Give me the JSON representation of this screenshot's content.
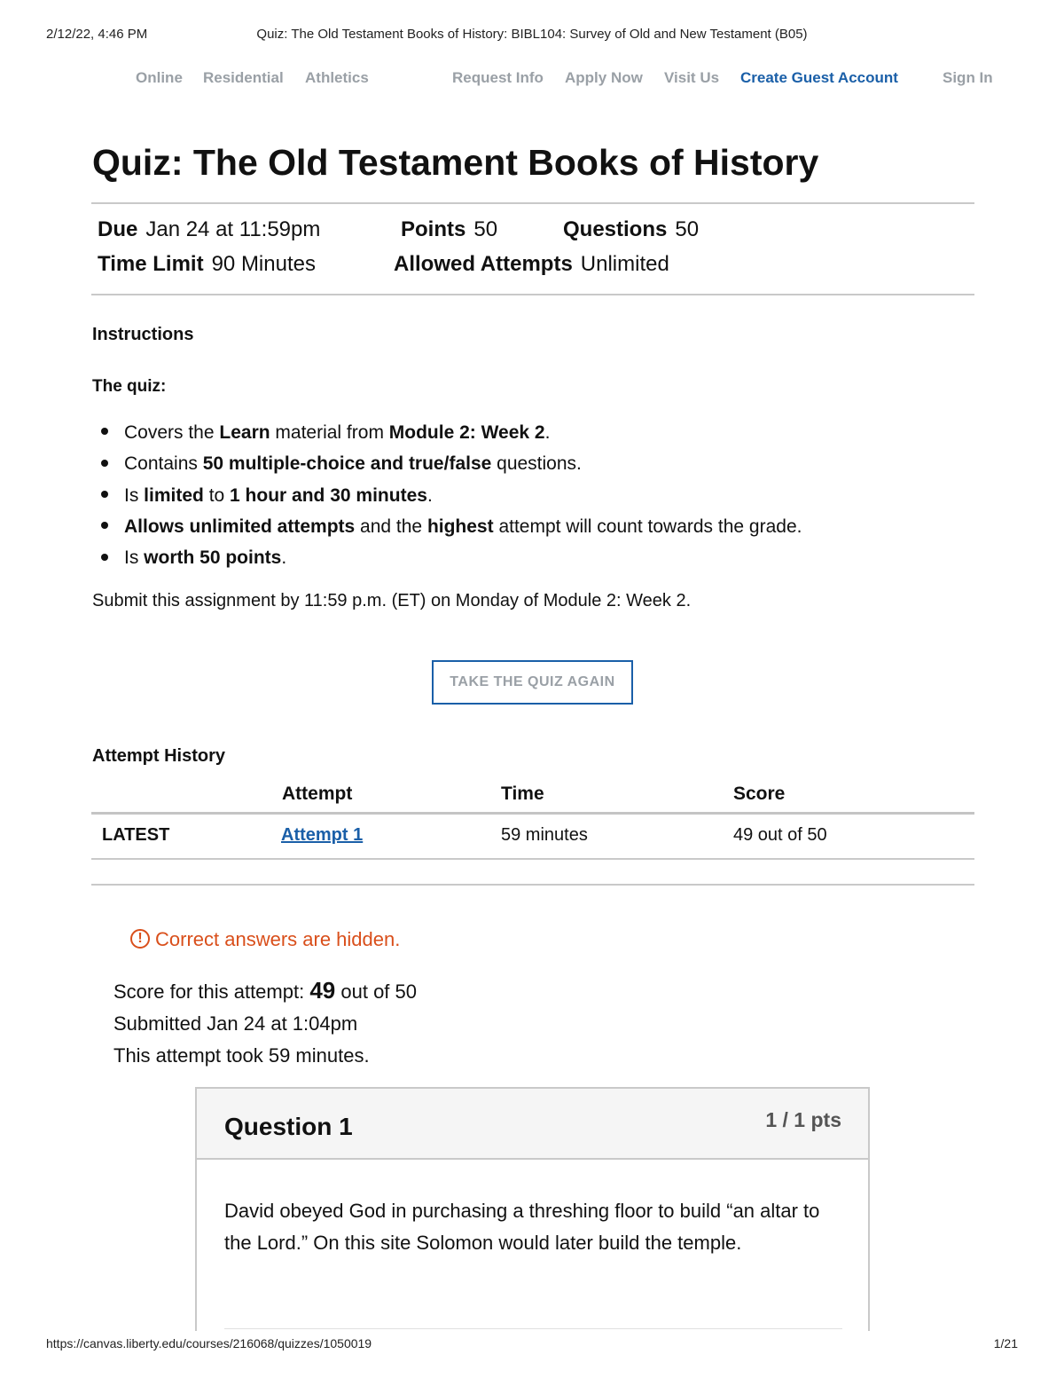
{
  "print": {
    "date": "2/12/22, 4:46 PM",
    "title": "Quiz: The Old Testament Books of History: BIBL104: Survey of Old and New Testament (B05)",
    "url": "https://canvas.liberty.edu/courses/216068/quizzes/1050019",
    "page": "1/21"
  },
  "nav": {
    "items": [
      "Online",
      "Residential",
      "Athletics",
      "Request Info",
      "Apply Now",
      "Visit Us",
      "Create Guest Account",
      "Sign In"
    ]
  },
  "quiz": {
    "title": "Quiz: The Old Testament Books of History",
    "meta": {
      "due_label": "Due",
      "due_value": "Jan 24 at 11:59pm",
      "points_label": "Points",
      "points_value": "50",
      "questions_label": "Questions",
      "questions_value": "50",
      "time_label": "Time Limit",
      "time_value": "90 Minutes",
      "attempts_label": "Allowed Attempts",
      "attempts_value": "Unlimited"
    }
  },
  "instructions": {
    "heading": "Instructions",
    "intro": "The quiz:",
    "bullets": [
      [
        {
          "t": "Covers the "
        },
        {
          "t": "Learn",
          "b": true
        },
        {
          "t": " material from "
        },
        {
          "t": "Module 2: Week 2",
          "b": true
        },
        {
          "t": "."
        }
      ],
      [
        {
          "t": "Contains "
        },
        {
          "t": "50 multiple-choice and true/false",
          "b": true
        },
        {
          "t": " questions."
        }
      ],
      [
        {
          "t": "Is "
        },
        {
          "t": "limited",
          "b": true
        },
        {
          "t": " to "
        },
        {
          "t": "1 hour and 30 minutes",
          "b": true
        },
        {
          "t": "."
        }
      ],
      [
        {
          "t": "Allows unlimited attempts",
          "b": true
        },
        {
          "t": " and the "
        },
        {
          "t": "highest",
          "b": true
        },
        {
          "t": " attempt will count towards the grade."
        }
      ],
      [
        {
          "t": "Is "
        },
        {
          "t": "worth 50 points",
          "b": true
        },
        {
          "t": "."
        }
      ]
    ],
    "submit_note": "Submit this assignment by 11:59 p.m. (ET) on Monday of Module 2: Week 2."
  },
  "actions": {
    "take_again": "TAKE THE QUIZ AGAIN"
  },
  "attempt_history": {
    "heading": "Attempt History",
    "columns": [
      "Attempt",
      "Time",
      "Score"
    ],
    "rows": [
      {
        "tag": "LATEST",
        "attempt": "Attempt 1",
        "time": "59 minutes",
        "score": "49 out of 50"
      }
    ]
  },
  "result": {
    "notice": "Correct answers are hidden.",
    "score_prefix": "Score for this attempt:",
    "score_value": "49",
    "score_suffix": "out of 50",
    "submitted": "Submitted Jan 24 at 1:04pm",
    "took": "This attempt took 59 minutes."
  },
  "question": {
    "title": "Question 1",
    "points": "1 / 1 pts",
    "text": "David obeyed God in purchasing a threshing floor to build “an altar to the Lord.” On this site Solomon would later build the temple."
  },
  "colors": {
    "accent": "#1a5fa8",
    "muted_nav": "#9aa0a6",
    "warning": "#d94f1b",
    "rule": "#c9c9c9"
  }
}
